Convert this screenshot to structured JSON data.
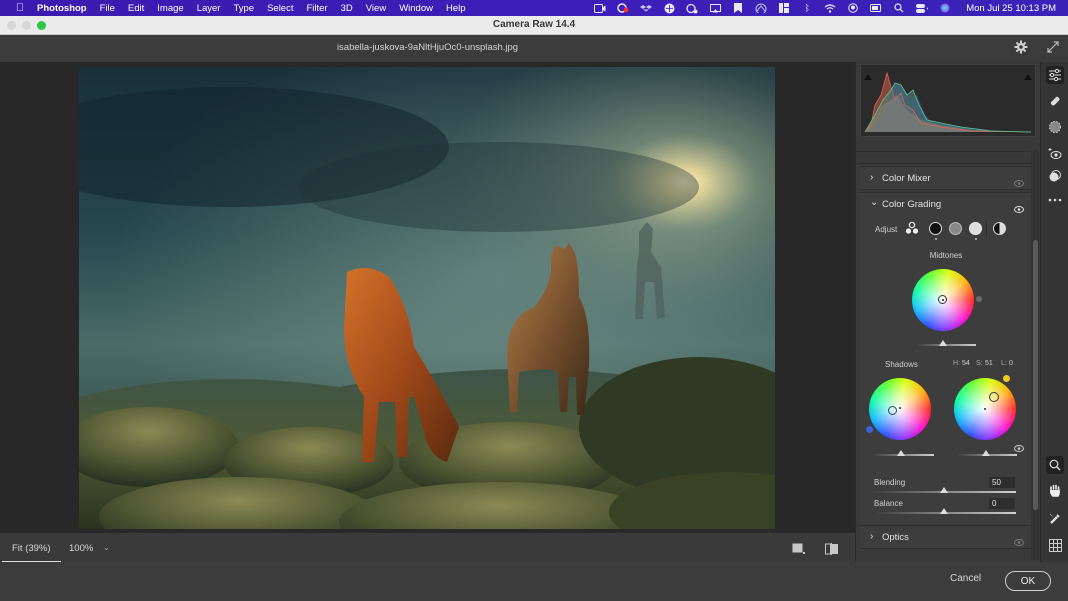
{
  "menubar": {
    "app_name": "Photoshop",
    "items": [
      "File",
      "Edit",
      "Image",
      "Layer",
      "Type",
      "Select",
      "Filter",
      "3D",
      "View",
      "Window",
      "Help"
    ],
    "status_icons": [
      "screen-record-icon",
      "creative-cloud-icon",
      "dropbox-icon",
      "vpn-icon",
      "screen-capture-icon",
      "airplay-icon",
      "bookmark-icon",
      "arc-icon",
      "grid-app-icon",
      "bluetooth-icon",
      "wifi-icon",
      "user-icon",
      "battery-icon",
      "search-icon",
      "control-center-icon",
      "siri-icon"
    ],
    "clock": "Mon Jul 25  10:13 PM"
  },
  "window": {
    "title": "Camera Raw 14.4",
    "filename": "isabella-juskova-9aNltHjuOc0-unsplash.jpg"
  },
  "bottom_bar": {
    "zoom_fit": "Fit (39%)",
    "zoom_100": "100%",
    "zoom_dropdown_glyph": "⌄"
  },
  "panel": {
    "sections": {
      "color_mixer": "Color Mixer",
      "color_grading": "Color Grading",
      "optics": "Optics"
    },
    "color_grading": {
      "adjust_label": "Adjust",
      "midtones_label": "Midtones",
      "shadows_label": "Shadows",
      "hsl_readout": {
        "h_label": "H:",
        "h": "54",
        "s_label": "S:",
        "s": "51",
        "l_label": "L:",
        "l": "0"
      },
      "midtones_luminance": 0,
      "shadows_luminance": 0,
      "highlights_luminance": 0,
      "blending_label": "Blending",
      "blending_value": "50",
      "balance_label": "Balance",
      "balance_value": "0"
    }
  },
  "footer": {
    "cancel": "Cancel",
    "ok": "OK"
  },
  "colors": {
    "menubar": "#3a1bb0",
    "window_bg": "#3a3a3a",
    "canvas_bg": "#282828",
    "highlight_handle": "#f2c81e",
    "shadow_handle": "#3a63d8"
  }
}
